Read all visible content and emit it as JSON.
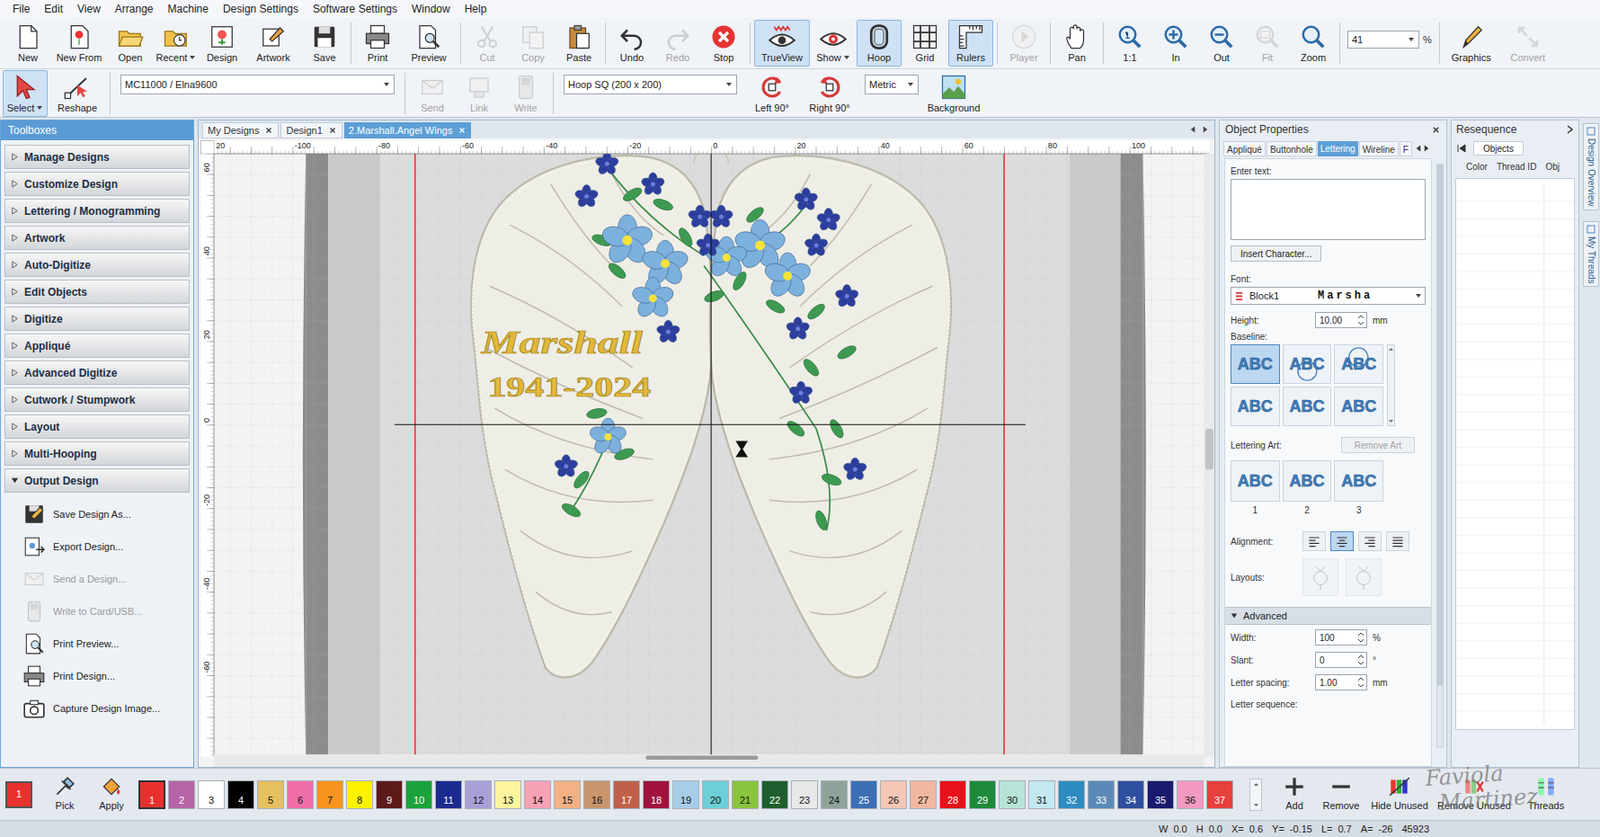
{
  "menu": [
    "File",
    "Edit",
    "View",
    "Arrange",
    "Machine",
    "Design Settings",
    "Software Settings",
    "Window",
    "Help"
  ],
  "toolbar": [
    {
      "label": "New",
      "disabled": false,
      "active": false,
      "dropdown": false
    },
    {
      "label": "New From",
      "disabled": false,
      "active": false,
      "dropdown": false
    },
    {
      "label": "Open",
      "disabled": false,
      "active": false,
      "dropdown": false
    },
    {
      "label": "Recent",
      "disabled": false,
      "active": false,
      "dropdown": true
    },
    {
      "label": "Design",
      "disabled": false,
      "active": false,
      "dropdown": false
    },
    {
      "label": "Artwork",
      "disabled": false,
      "active": false,
      "dropdown": false
    },
    {
      "label": "Save",
      "disabled": false,
      "active": false,
      "dropdown": false
    },
    {
      "label": "Print",
      "disabled": false,
      "active": false,
      "dropdown": false
    },
    {
      "label": "Preview",
      "disabled": false,
      "active": false,
      "dropdown": false
    },
    {
      "label": "Cut",
      "disabled": true,
      "active": false,
      "dropdown": false
    },
    {
      "label": "Copy",
      "disabled": true,
      "active": false,
      "dropdown": false
    },
    {
      "label": "Paste",
      "disabled": false,
      "active": false,
      "dropdown": false
    },
    {
      "label": "Undo",
      "disabled": false,
      "active": false,
      "dropdown": false
    },
    {
      "label": "Redo",
      "disabled": true,
      "active": false,
      "dropdown": false
    },
    {
      "label": "Stop",
      "disabled": false,
      "active": false,
      "dropdown": false
    },
    {
      "label": "TrueView",
      "disabled": false,
      "active": true,
      "dropdown": false
    },
    {
      "label": "Show",
      "disabled": false,
      "active": false,
      "dropdown": true
    },
    {
      "label": "Hoop",
      "disabled": false,
      "active": true,
      "dropdown": false
    },
    {
      "label": "Grid",
      "disabled": false,
      "active": false,
      "dropdown": false
    },
    {
      "label": "Rulers",
      "disabled": false,
      "active": true,
      "dropdown": false
    },
    {
      "label": "Player",
      "disabled": true,
      "active": false,
      "dropdown": false
    },
    {
      "label": "Pan",
      "disabled": false,
      "active": false,
      "dropdown": false
    },
    {
      "label": "1:1",
      "disabled": false,
      "active": false,
      "dropdown": false
    },
    {
      "label": "In",
      "disabled": false,
      "active": false,
      "dropdown": false
    },
    {
      "label": "Out",
      "disabled": false,
      "active": false,
      "dropdown": false
    },
    {
      "label": "Fit",
      "disabled": true,
      "active": false,
      "dropdown": false
    },
    {
      "label": "Zoom",
      "disabled": false,
      "active": false,
      "dropdown": false
    }
  ],
  "zoom_field": {
    "value": "41",
    "unit": "%"
  },
  "toolbar_end": [
    {
      "label": "Graphics",
      "disabled": false
    },
    {
      "label": "Convert",
      "disabled": true
    }
  ],
  "toolbar2": [
    {
      "kind": "button",
      "label": "Select",
      "disabled": false,
      "active": true,
      "dropdown": true
    },
    {
      "kind": "button",
      "label": "Reshape",
      "disabled": false,
      "active": false,
      "dropdown": false
    },
    {
      "kind": "dropdown",
      "label": "MC11000 / Elna9600",
      "disabled": false,
      "active": false,
      "dropdown": true
    },
    {
      "kind": "button",
      "label": "Send",
      "disabled": true,
      "active": false,
      "dropdown": false
    },
    {
      "kind": "button",
      "label": "Link",
      "disabled": true,
      "active": false,
      "dropdown": false
    },
    {
      "kind": "button",
      "label": "Write",
      "disabled": true,
      "active": false,
      "dropdown": false
    },
    {
      "kind": "dropdown",
      "label": "Hoop SQ (200 x 200)",
      "disabled": false,
      "active": false,
      "dropdown": true
    },
    {
      "kind": "button",
      "label": "Left 90°",
      "disabled": false,
      "active": false,
      "dropdown": false
    },
    {
      "kind": "button",
      "label": "Right 90°",
      "disabled": false,
      "active": false,
      "dropdown": false
    },
    {
      "kind": "dropdown",
      "label": "Metric",
      "disabled": false,
      "active": false,
      "dropdown": true
    },
    {
      "kind": "button",
      "label": "Background",
      "disabled": false,
      "active": false,
      "dropdown": false
    }
  ],
  "toolboxes": {
    "title": "Toolboxes",
    "items": [
      {
        "label": "Manage Designs",
        "expanded": false
      },
      {
        "label": "Customize Design",
        "expanded": false
      },
      {
        "label": "Lettering / Monogramming",
        "expanded": false
      },
      {
        "label": "Artwork",
        "expanded": false
      },
      {
        "label": "Auto-Digitize",
        "expanded": false
      },
      {
        "label": "Edit Objects",
        "expanded": false
      },
      {
        "label": "Digitize",
        "expanded": false
      },
      {
        "label": "Appliqué",
        "expanded": false
      },
      {
        "label": "Advanced Digitize",
        "expanded": false
      },
      {
        "label": "Cutwork / Stumpwork",
        "expanded": false
      },
      {
        "label": "Layout",
        "expanded": false
      },
      {
        "label": "Multi-Hooping",
        "expanded": false
      },
      {
        "label": "Output Design",
        "expanded": true
      }
    ],
    "sub_items": [
      {
        "label": "Save Design As...",
        "disabled": false
      },
      {
        "label": "Export Design...",
        "disabled": false
      },
      {
        "label": "Send a Design...",
        "disabled": true
      },
      {
        "label": "Write to Card/USB...",
        "disabled": true
      },
      {
        "label": "Print Preview...",
        "disabled": false
      },
      {
        "label": "Print Design...",
        "disabled": false
      },
      {
        "label": "Capture Design Image...",
        "disabled": false
      }
    ]
  },
  "doc_tabs": [
    {
      "label": "My Designs",
      "selected": false
    },
    {
      "label": "Design1",
      "selected": false
    },
    {
      "label": "2.Marshall.Angel Wings",
      "selected": true
    }
  ],
  "rulers": {
    "horizontal": [
      "20",
      "-100",
      "-80",
      "-60",
      "-40",
      "-20",
      "0",
      "20",
      "40",
      "60",
      "80",
      "100"
    ],
    "vertical": [
      "60",
      "40",
      "20",
      "0",
      "-20",
      "-40",
      "-60"
    ]
  },
  "design": {
    "lettering": [
      "Marshall",
      "1941-2024"
    ]
  },
  "object_properties": {
    "title": "Object Properties",
    "tabs": [
      {
        "label": "Appliqué",
        "selected": false
      },
      {
        "label": "Buttonhole",
        "selected": false
      },
      {
        "label": "Lettering",
        "selected": true
      },
      {
        "label": "Wireline",
        "selected": false
      },
      {
        "label": "F",
        "selected": false
      }
    ],
    "enter_text": {
      "label": "Enter text:",
      "value": ""
    },
    "insert_character": "Insert Character...",
    "font": {
      "label": "Font:",
      "value": "Block1",
      "preview": "Marsha"
    },
    "height": {
      "label": "Height:",
      "value": "10.00",
      "unit": "mm"
    },
    "baseline": {
      "label": "Baseline:",
      "options": [
        {
          "label": "ABC",
          "selected": true
        },
        {
          "label": "ABC",
          "selected": false
        },
        {
          "label": "ABC",
          "selected": false
        },
        {
          "label": "ABC",
          "selected": false
        },
        {
          "label": "ABC",
          "selected": false
        },
        {
          "label": "ABC",
          "selected": false
        }
      ]
    },
    "lettering_art": {
      "label": "Lettering Art:",
      "button": "Remove Art",
      "button_disabled": true,
      "options": [
        {
          "label": "ABC",
          "number": "1"
        },
        {
          "label": "ABC",
          "number": "2"
        },
        {
          "label": "ABC",
          "number": "3"
        }
      ]
    },
    "alignment": {
      "label": "Alignment:",
      "options": [
        {
          "selected": false
        },
        {
          "selected": true
        },
        {
          "selected": false
        },
        {
          "selected": false
        }
      ]
    },
    "layouts": {
      "label": "Layouts:",
      "options": [
        {
          "disabled": true
        },
        {
          "disabled": true
        }
      ]
    },
    "advanced": {
      "label": "Advanced",
      "expanded": true,
      "fields": [
        {
          "kind": "spin",
          "label": "Width:",
          "value": "100",
          "unit": "%"
        },
        {
          "kind": "spin",
          "label": "Slant:",
          "value": "0",
          "unit": "°"
        },
        {
          "kind": "spin",
          "label": "Letter spacing:",
          "value": "1.00",
          "unit": "mm"
        },
        {
          "kind": "label",
          "label": "Letter sequence:",
          "value": "",
          "unit": ""
        }
      ]
    }
  },
  "resequence": {
    "title": "Resequence",
    "tab": "Objects",
    "columns": [
      "Color",
      "Thread ID",
      "Obj"
    ]
  },
  "side_tabs": [
    "Design Overview",
    "My Threads"
  ],
  "palette": {
    "current": {
      "number": "1",
      "color": "#e8312f"
    },
    "tools": [
      {
        "label": "Pick"
      },
      {
        "label": "Apply"
      }
    ],
    "colors": [
      {
        "number": "1",
        "color": "#e8312f",
        "selected": true
      },
      {
        "number": "2",
        "color": "#b565a7",
        "selected": false
      },
      {
        "number": "3",
        "color": "#ffffff",
        "selected": false
      },
      {
        "number": "4",
        "color": "#000000",
        "selected": false
      },
      {
        "number": "5",
        "color": "#e6bf5e",
        "selected": false
      },
      {
        "number": "6",
        "color": "#f06eaa",
        "selected": false
      },
      {
        "number": "7",
        "color": "#f7941d",
        "selected": false
      },
      {
        "number": "8",
        "color": "#fff200",
        "selected": false
      },
      {
        "number": "9",
        "color": "#5c1a1a",
        "selected": false
      },
      {
        "number": "10",
        "color": "#1aa33a",
        "selected": false
      },
      {
        "number": "11",
        "color": "#1c2b8f",
        "selected": false
      },
      {
        "number": "12",
        "color": "#a9a0d8",
        "selected": false
      },
      {
        "number": "13",
        "color": "#fff59d",
        "selected": false
      },
      {
        "number": "14",
        "color": "#f7a1b5",
        "selected": false
      },
      {
        "number": "15",
        "color": "#f4b183",
        "selected": false
      },
      {
        "number": "16",
        "color": "#c8956d",
        "selected": false
      },
      {
        "number": "17",
        "color": "#c0604a",
        "selected": false
      },
      {
        "number": "18",
        "color": "#a0123c",
        "selected": false
      },
      {
        "number": "19",
        "color": "#a8cde8",
        "selected": false
      },
      {
        "number": "20",
        "color": "#6dcfd8",
        "selected": false
      },
      {
        "number": "21",
        "color": "#8ac43f",
        "selected": false
      },
      {
        "number": "22",
        "color": "#1f5e2e",
        "selected": false
      },
      {
        "number": "23",
        "color": "#e8e8e8",
        "selected": false
      },
      {
        "number": "24",
        "color": "#8fa39b",
        "selected": false
      },
      {
        "number": "25",
        "color": "#3d6fb5",
        "selected": false
      },
      {
        "number": "26",
        "color": "#f4c6b5",
        "selected": false
      },
      {
        "number": "27",
        "color": "#f2b7a0",
        "selected": false
      },
      {
        "number": "28",
        "color": "#e8101a",
        "selected": false
      },
      {
        "number": "29",
        "color": "#1d8a3a",
        "selected": false
      },
      {
        "number": "30",
        "color": "#b7e4d8",
        "selected": false
      },
      {
        "number": "31",
        "color": "#c4e8f0",
        "selected": false
      },
      {
        "number": "32",
        "color": "#2e8bbf",
        "selected": false
      },
      {
        "number": "33",
        "color": "#5b8ab8",
        "selected": false
      },
      {
        "number": "34",
        "color": "#2e4f9e",
        "selected": false
      },
      {
        "number": "35",
        "color": "#1a1a6e",
        "selected": false
      },
      {
        "number": "36",
        "color": "#f49ac1",
        "selected": false
      },
      {
        "number": "37",
        "color": "#e8403c",
        "selected": false
      }
    ],
    "actions": [
      {
        "label": "Add",
        "disabled": false
      },
      {
        "label": "Remove",
        "disabled": false
      },
      {
        "label": "Hide Unused",
        "disabled": false
      },
      {
        "label": "Remove Unused",
        "disabled": false
      },
      {
        "label": "Threads",
        "disabled": false
      }
    ]
  },
  "watermark": [
    "Faviola",
    "Martinez"
  ],
  "status_bar": [
    {
      "label": "W",
      "value": "0.0"
    },
    {
      "label": "H",
      "value": "0.0"
    },
    {
      "label": "X=",
      "value": "0.6"
    },
    {
      "label": "Y=",
      "value": "-0.15"
    },
    {
      "label": "L=",
      "value": "0.7"
    },
    {
      "label": "A=",
      "value": "-26"
    },
    {
      "label": "",
      "value": "45923"
    }
  ]
}
